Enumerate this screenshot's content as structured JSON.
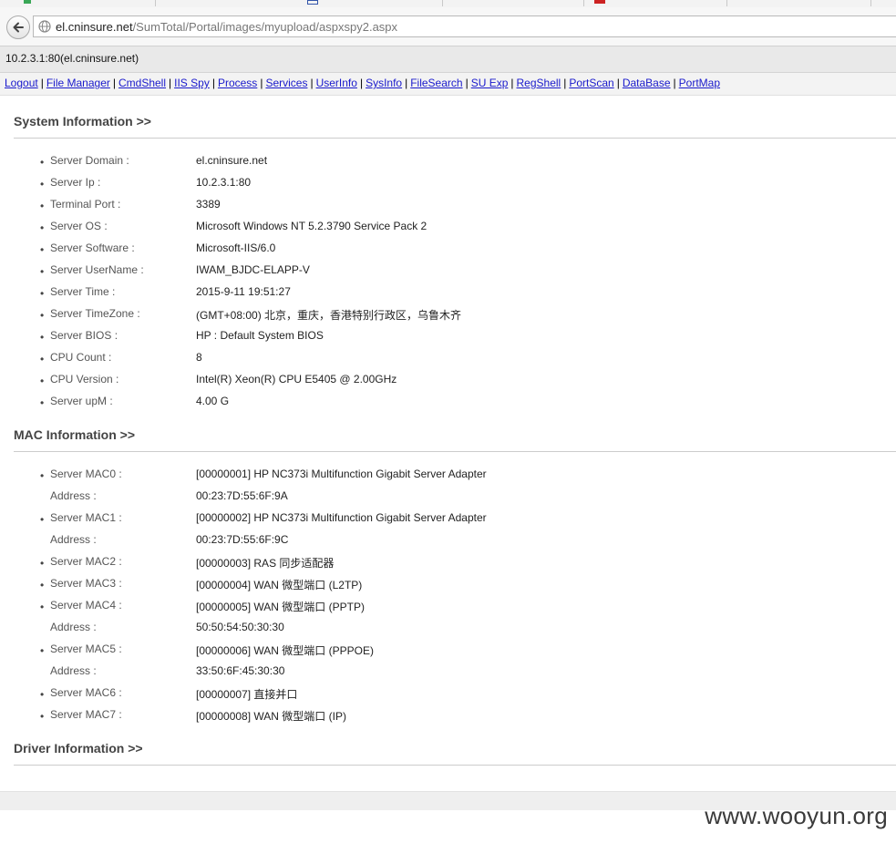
{
  "browser": {
    "url_host": "el.cninsure.net",
    "url_path": "/SumTotal/Portal/images/myupload/aspxspy2.aspx"
  },
  "hostname_bar": "10.2.3.1:80(el.cninsure.net)",
  "nav": {
    "links": [
      "Logout",
      "File Manager",
      "CmdShell",
      "IIS Spy",
      "Process",
      "Services",
      "UserInfo",
      "SysInfo",
      "FileSearch",
      "SU Exp",
      "RegShell",
      "PortScan",
      "DataBase",
      "PortMap"
    ],
    "separator": "|"
  },
  "system": {
    "title": "System Information >>",
    "rows": [
      {
        "label": "Server Domain :",
        "value": "el.cninsure.net"
      },
      {
        "label": "Server Ip :",
        "value": "10.2.3.1:80"
      },
      {
        "label": "Terminal Port :",
        "value": "3389"
      },
      {
        "label": "Server OS :",
        "value": "Microsoft Windows NT 5.2.3790 Service Pack 2"
      },
      {
        "label": "Server Software :",
        "value": "Microsoft-IIS/6.0"
      },
      {
        "label": "Server UserName :",
        "value": "IWAM_BJDC-ELAPP-V"
      },
      {
        "label": "Server Time :",
        "value": "2015-9-11 19:51:27"
      },
      {
        "label": "Server TimeZone :",
        "value": "(GMT+08:00) 北京，重庆，香港特别行政区，乌鲁木齐"
      },
      {
        "label": "Server BIOS :",
        "value": "HP : Default System BIOS"
      },
      {
        "label": "CPU Count :",
        "value": "8"
      },
      {
        "label": "CPU Version :",
        "value": "Intel(R) Xeon(R) CPU E5405 @ 2.00GHz"
      },
      {
        "label": "Server upM :",
        "value": "4.00 G"
      }
    ]
  },
  "mac": {
    "title": "MAC Information >>",
    "rows": [
      {
        "bullet": true,
        "label": "Server MAC0 :",
        "value": "[00000001] HP NC373i Multifunction Gigabit Server Adapter"
      },
      {
        "bullet": false,
        "label": "Address :",
        "value": "00:23:7D:55:6F:9A"
      },
      {
        "bullet": true,
        "label": "Server MAC1 :",
        "value": "[00000002] HP NC373i Multifunction Gigabit Server Adapter"
      },
      {
        "bullet": false,
        "label": "Address :",
        "value": "00:23:7D:55:6F:9C"
      },
      {
        "bullet": true,
        "label": "Server MAC2 :",
        "value": "[00000003] RAS 同步适配器"
      },
      {
        "bullet": true,
        "label": "Server MAC3 :",
        "value": "[00000004] WAN 微型端口 (L2TP)"
      },
      {
        "bullet": true,
        "label": "Server MAC4 :",
        "value": "[00000005] WAN 微型端口 (PPTP)"
      },
      {
        "bullet": false,
        "label": "Address :",
        "value": "50:50:54:50:30:30"
      },
      {
        "bullet": true,
        "label": "Server MAC5 :",
        "value": "[00000006] WAN 微型端口 (PPPOE)"
      },
      {
        "bullet": false,
        "label": "Address :",
        "value": "33:50:6F:45:30:30"
      },
      {
        "bullet": true,
        "label": "Server MAC6 :",
        "value": "[00000007] 直接并口"
      },
      {
        "bullet": true,
        "label": "Server MAC7 :",
        "value": "[00000008] WAN 微型端口 (IP)"
      }
    ]
  },
  "driver": {
    "title": "Driver Information >>"
  },
  "watermark": "www.wooyun.org",
  "icons": {
    "back": "back-arrow-icon",
    "site": "globe-icon",
    "bullet": "•"
  }
}
